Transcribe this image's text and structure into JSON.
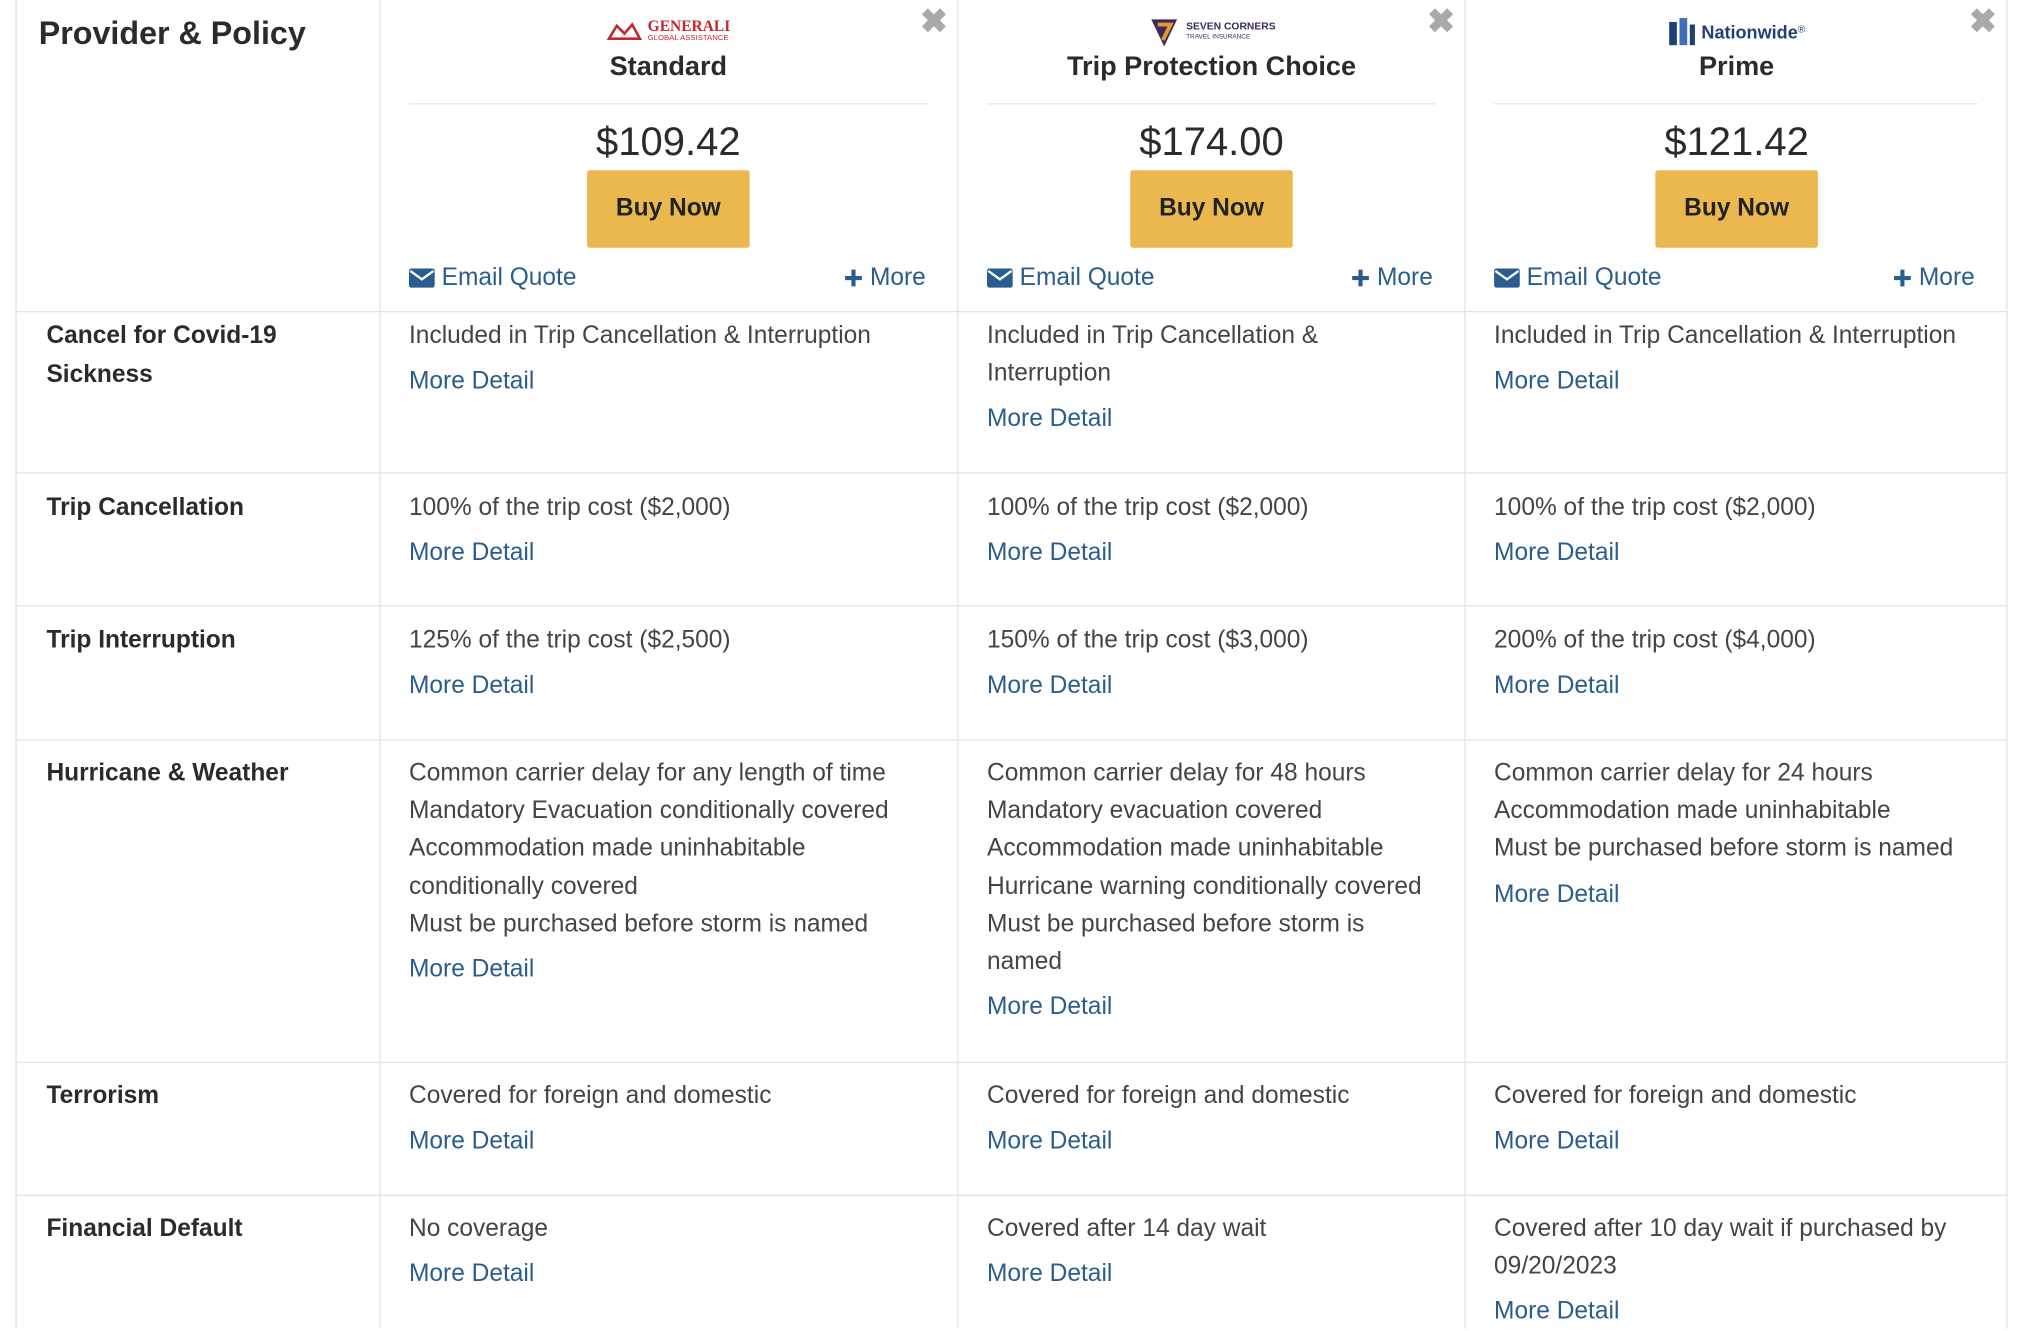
{
  "header": {
    "title": "Provider & Policy"
  },
  "colors": {
    "accent_button": "#ebb84f",
    "link": "#2a5d8f",
    "close": "#a9a9a9",
    "grid": "#e3e3e3"
  },
  "plans": [
    {
      "logo_icon": "generali-logo",
      "logo_text": "GENERALI",
      "logo_subtext": "GLOBAL ASSISTANCE",
      "logo_color": "#c8262e",
      "name": "Standard",
      "price": "$109.42",
      "buy_label": "Buy Now",
      "email_label": "Email Quote",
      "more_label": "More"
    },
    {
      "logo_icon": "seven-corners-logo",
      "logo_text": "SEVEN CORNERS",
      "logo_subtext": "TRAVEL INSURANCE",
      "logo_color": "#3d2a5c",
      "name": "Trip Protection Choice",
      "price": "$174.00",
      "buy_label": "Buy Now",
      "email_label": "Email Quote",
      "more_label": "More"
    },
    {
      "logo_icon": "nationwide-logo",
      "logo_text": "Nationwide",
      "logo_subtext": "®",
      "logo_color": "#1f3f7a",
      "name": "Prime",
      "price": "$121.42",
      "buy_label": "Buy Now",
      "email_label": "Email Quote",
      "more_label": "More"
    }
  ],
  "rows": [
    {
      "label": "Cancel for Covid-19 Sickness",
      "cells": [
        {
          "lines": [
            "Included in Trip Cancellation & Interruption"
          ],
          "detail": "More Detail"
        },
        {
          "lines": [
            "Included in Trip Cancellation &",
            "Interruption"
          ],
          "detail": "More Detail"
        },
        {
          "lines": [
            "Included in Trip Cancellation & Interruption"
          ],
          "detail": "More Detail"
        }
      ]
    },
    {
      "label": "Trip Cancellation",
      "cells": [
        {
          "lines": [
            "100% of the trip cost ($2,000)"
          ],
          "detail": "More Detail"
        },
        {
          "lines": [
            "100% of the trip cost ($2,000)"
          ],
          "detail": "More Detail"
        },
        {
          "lines": [
            "100% of the trip cost ($2,000)"
          ],
          "detail": "More Detail"
        }
      ]
    },
    {
      "label": "Trip Interruption",
      "cells": [
        {
          "lines": [
            "125% of the trip cost ($2,500)"
          ],
          "detail": "More Detail"
        },
        {
          "lines": [
            "150% of the trip cost ($3,000)"
          ],
          "detail": "More Detail"
        },
        {
          "lines": [
            "200% of the trip cost ($4,000)"
          ],
          "detail": "More Detail"
        }
      ]
    },
    {
      "label": "Hurricane & Weather",
      "cells": [
        {
          "lines": [
            "Common carrier delay for any length of time",
            "Mandatory Evacuation conditionally covered",
            "Accommodation made uninhabitable",
            "conditionally covered",
            "Must be purchased before storm is named"
          ],
          "detail": "More Detail"
        },
        {
          "lines": [
            "Common carrier delay for 48 hours",
            "Mandatory evacuation covered",
            "Accommodation made uninhabitable",
            "Hurricane warning conditionally covered",
            "Must be purchased before storm is",
            "named"
          ],
          "detail": "More Detail"
        },
        {
          "lines": [
            "Common carrier delay for 24 hours",
            "Accommodation made uninhabitable",
            "Must be purchased before storm is named"
          ],
          "detail": "More Detail"
        }
      ]
    },
    {
      "label": "Terrorism",
      "cells": [
        {
          "lines": [
            "Covered for foreign and domestic"
          ],
          "detail": "More Detail"
        },
        {
          "lines": [
            "Covered for foreign and domestic"
          ],
          "detail": "More Detail"
        },
        {
          "lines": [
            "Covered for foreign and domestic"
          ],
          "detail": "More Detail"
        }
      ]
    },
    {
      "label": "Financial Default",
      "cells": [
        {
          "lines": [
            "No coverage"
          ],
          "detail": "More Detail"
        },
        {
          "lines": [
            "Covered after 14 day wait"
          ],
          "detail": "More Detail"
        },
        {
          "lines": [
            "Covered after 10 day wait if purchased by",
            "09/20/2023"
          ],
          "detail": "More Detail"
        }
      ]
    }
  ]
}
